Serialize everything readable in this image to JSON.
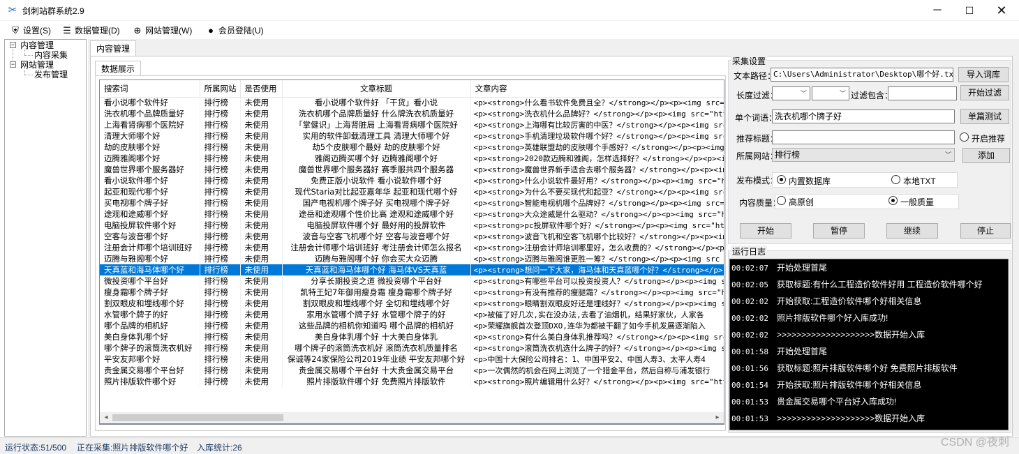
{
  "window": {
    "title": "剑刺站群系统2.9"
  },
  "menu": [
    {
      "label": "设置(S)",
      "icon": "shield-icon"
    },
    {
      "label": "数据管理(D)",
      "icon": "database-icon"
    },
    {
      "label": "网站管理(W)",
      "icon": "globe-icon"
    },
    {
      "label": "会员登陆(U)",
      "icon": "user-icon"
    }
  ],
  "tree": {
    "content_mgmt": "内容管理",
    "content_collect": "内容采集",
    "site_mgmt": "网站管理",
    "publish_mgmt": "发布管理"
  },
  "tabs": {
    "main": "内容管理",
    "sub": "数据展示"
  },
  "grid": {
    "columns": [
      "搜索词",
      "所属网站",
      "是否使用",
      "文章标题",
      "文章内容"
    ],
    "rows": [
      [
        "看小说哪个软件好",
        "排行榜",
        "未使用",
        "看小说哪个软件好 「干货」看小说",
        "<p><strong>什么看书软件免费且全？</strong></p><p><img src=\""
      ],
      [
        "洗衣机哪个品牌质量好",
        "排行榜",
        "未使用",
        "洗衣机哪个品牌质量好 什么牌洗衣机质量好",
        "<p><strong>洗衣机什么品牌好？</strong></p><p><img src=\"http"
      ],
      [
        "上海看肾病哪个医院好",
        "排行榜",
        "未使用",
        "「掌健识」上海肾脏局 上海看肾病哪个医院好",
        "<p><strong>上海哪有比较厉害的中医？</strong></p><p><img src="
      ],
      [
        "清理大师哪个好",
        "排行榜",
        "未使用",
        "实用的软件卸载清理工具 清理大师哪个好",
        "<p><strong>手机清理垃圾软件哪个好？</strong></p><p><img src"
      ],
      [
        "劫的皮肤哪个好",
        "排行榜",
        "未使用",
        "劫5个皮肤哪个最好 劫的皮肤哪个好",
        "<p><strong>英雄联盟劫的皮肤哪个手感好？</strong></p><p><img"
      ],
      [
        "迈腾雅阁哪个好",
        "排行榜",
        "未使用",
        "雅阁迈腾买哪个好 迈腾雅阁哪个好",
        "<p><strong>2020款迈腾和雅阁，怎样选择好？</strong></p><p><im"
      ],
      [
        "魔兽世界哪个服务器好",
        "排行榜",
        "未使用",
        "魔兽世界哪个服务器好 赛季服共四个服务器",
        "<p><strong>魔兽世界新手适合去哪个服务器？</strong></p><p><im"
      ],
      [
        "看小说软件哪个好",
        "排行榜",
        "未使用",
        "免费正版小说软件 看小说软件哪个好",
        "<p><strong>什么小说软件最好用？</strong></p><p><img src=\"h"
      ],
      [
        "起亚和现代哪个好",
        "排行榜",
        "未使用",
        "现代Staria对比起亚嘉年华 起亚和现代哪个好",
        "<p><strong>为什么不要买现代和起亚？</strong></p><p><img src"
      ],
      [
        "买电视哪个牌子好",
        "排行榜",
        "未使用",
        "国产电视机哪个牌子好 买电视哪个牌子好",
        "<p><strong>智能电视机哪个品牌好？</strong></p><p><img src=\""
      ],
      [
        "途观和途威哪个好",
        "排行榜",
        "未使用",
        "途岳和途观哪个性价比高 途观和途威哪个好",
        "<p><strong>大众途威是什么驱动？</strong></p><p><img src=\"ht"
      ],
      [
        "电脑投屏软件哪个好",
        "排行榜",
        "未使用",
        "电脑投屏软件哪个好 最好用的投屏软件",
        "<p><strong>pc投屏软件哪个好？</strong></p><p><img src=\"http"
      ],
      [
        "空客与波音哪个好",
        "排行榜",
        "未使用",
        "波音与空客飞机哪个好 空客与波音哪个好",
        "<p><strong>波音飞机和空客飞机哪个比较好？</strong></p><p><im"
      ],
      [
        "注册会计师哪个培训班好",
        "排行榜",
        "未使用",
        "注册会计师哪个培训班好 考注册会计师怎么报名",
        "<p><strong>注册会计师培训哪里好，怎么收费的？</strong></p><p>"
      ],
      [
        "迈腾与雅阁哪个好",
        "排行榜",
        "未使用",
        "迈腾与雅阁哪个好 你会买大众迈腾",
        "<p><strong>迈腾与雅阁谁更胜一筹？</strong></p><p><img src"
      ],
      [
        "天真蓝和海马体哪个好",
        "排行榜",
        "未使用",
        "天真蓝和海马体哪个好 海马体VS天真蓝",
        "<p><strong>想问一下大家，海马体和天真蓝哪个好？</strong></p>"
      ],
      [
        "微投资哪个平台好",
        "排行榜",
        "未使用",
        "分享长期投资之道 微投资哪个平台好",
        "<p><strong>有哪些平台可以投资投资人？</strong></p><p><img src"
      ],
      [
        "瘦身霜哪个牌子好",
        "排行榜",
        "未使用",
        "凯特王妃7年御用瘦身霜 瘦身霜哪个牌子好",
        "<p><strong>有没有推荐的瘦腿霜？</strong></p><p><img src=\"ht"
      ],
      [
        "割双眼皮和埋线哪个好",
        "排行榜",
        "未使用",
        "割双眼皮和埋线哪个好 全切和埋线哪个好",
        "<p><strong>眼睛割双眼皮好还是埋线好？</strong></p><p><img s"
      ],
      [
        "水管哪个牌子的好",
        "排行榜",
        "未使用",
        "家用水管哪个牌子好 水管哪个牌子的好",
        "<p>被催了好几次,实在没办法,去看了油烟机，结果好家伙，人家各"
      ],
      [
        "哪个品牌的相机好",
        "排行榜",
        "未使用",
        "这些品牌的相机你知道吗 哪个品牌的相机好",
        "<p>荣耀旗舰首次登顶DXO,连华为都被干翻了如今手机发展逐渐陷入"
      ],
      [
        "美白身体乳哪个好",
        "排行榜",
        "未使用",
        "美白身体乳哪个好 十大美白身体乳",
        "<p><strong>有什么美白身体乳推荐吗？</strong></p><p><img src"
      ],
      [
        "哪个牌子的滚筒洗衣机好",
        "排行榜",
        "未使用",
        "哪个牌子的滚筒洗衣机好 滚筒洗衣机质量排名",
        "<p><strong>滚筒洗衣机选什么牌子的好？</strong></p><p><img s"
      ],
      [
        "平安友邦哪个好",
        "排行榜",
        "未使用",
        "保诚等24家保险公司2019年业绩 平安友邦哪个好",
        "<p>中国十大保险公司排名：1、中国平安2、中国人寿3、太平人寿4"
      ],
      [
        "贵金属交易哪个平台好",
        "排行榜",
        "未使用",
        "贵金属交易哪个平台好 十大贵金属交易平台",
        "<p>一次偶然的机会在网上浏览了一个猎金平台，然后自称与浦发银行"
      ],
      [
        "照片排版软件哪个好",
        "排行榜",
        "未使用",
        "照片排版软件哪个好 免费照片排版软件",
        "<p><strong>照片编辑用什么好？</strong></p><p><img src=\"http"
      ]
    ],
    "selected_index": 15,
    "scroll_left_label": "◂",
    "scroll_right_label": "▸"
  },
  "settings": {
    "group_title": "采集设置",
    "file_path_label": "文本路径：",
    "file_path_value": "C:\\Users\\Administrator\\Desktop\\哪个好.txt",
    "import_button": "导入词库",
    "length_filter_label": "长度过滤：",
    "filter_contains_label": "过滤包含：",
    "start_filter_button": "开始过滤",
    "single_word_label": "单个词语：",
    "single_word_value": "洗衣机哪个牌子好",
    "single_test_button": "单篇测试",
    "recommend_title_label": "推荐标题：",
    "enable_recommend_label": "开启推荐",
    "site_label": "所属网站：",
    "site_value": "排行榜",
    "add_button": "添加",
    "publish_mode_label": "发布模式：",
    "mode_builtin_db": "内置数据库",
    "mode_local_txt": "本地TXT",
    "quality_label": "内容质量：",
    "quality_high": "高原创",
    "quality_normal": "一般质量",
    "start_button": "开始",
    "pause_button": "暂停",
    "continue_button": "继续",
    "stop_button": "停止"
  },
  "log": {
    "title": "运行日志",
    "lines": [
      {
        "time": "00:02:07",
        "text": "开始处理首尾"
      },
      {
        "time": "00:02:05",
        "text": "获取标题:有什么工程造价软件好用 工程造价软件哪个好"
      },
      {
        "time": "00:02:02",
        "text": "开始获取:工程造价软件哪个好相关信息"
      },
      {
        "time": "00:02:02",
        "text": "照片排版软件哪个好入库成功!"
      },
      {
        "time": "00:02:02",
        "text": ">>>>>>>>>>>>>>>>>>>>数据开始入库"
      },
      {
        "time": "00:01:58",
        "text": "开始处理首尾"
      },
      {
        "time": "00:01:56",
        "text": "获取标题:照片排版软件哪个好 免费照片排版软件"
      },
      {
        "time": "00:01:54",
        "text": "开始获取:照片排版软件哪个好相关信息"
      },
      {
        "time": "00:01:53",
        "text": "贵金属交易哪个平台好入库成功!"
      },
      {
        "time": "00:01:53",
        "text": ">>>>>>>>>>>>>>>>>>>>数据开始入库"
      }
    ]
  },
  "status": {
    "run_state": "运行状态:51/500",
    "collecting": "正在采集:照片排版软件哪个好",
    "stored_count": "入库统计:26",
    "watermark": "CSDN @夜刺"
  }
}
